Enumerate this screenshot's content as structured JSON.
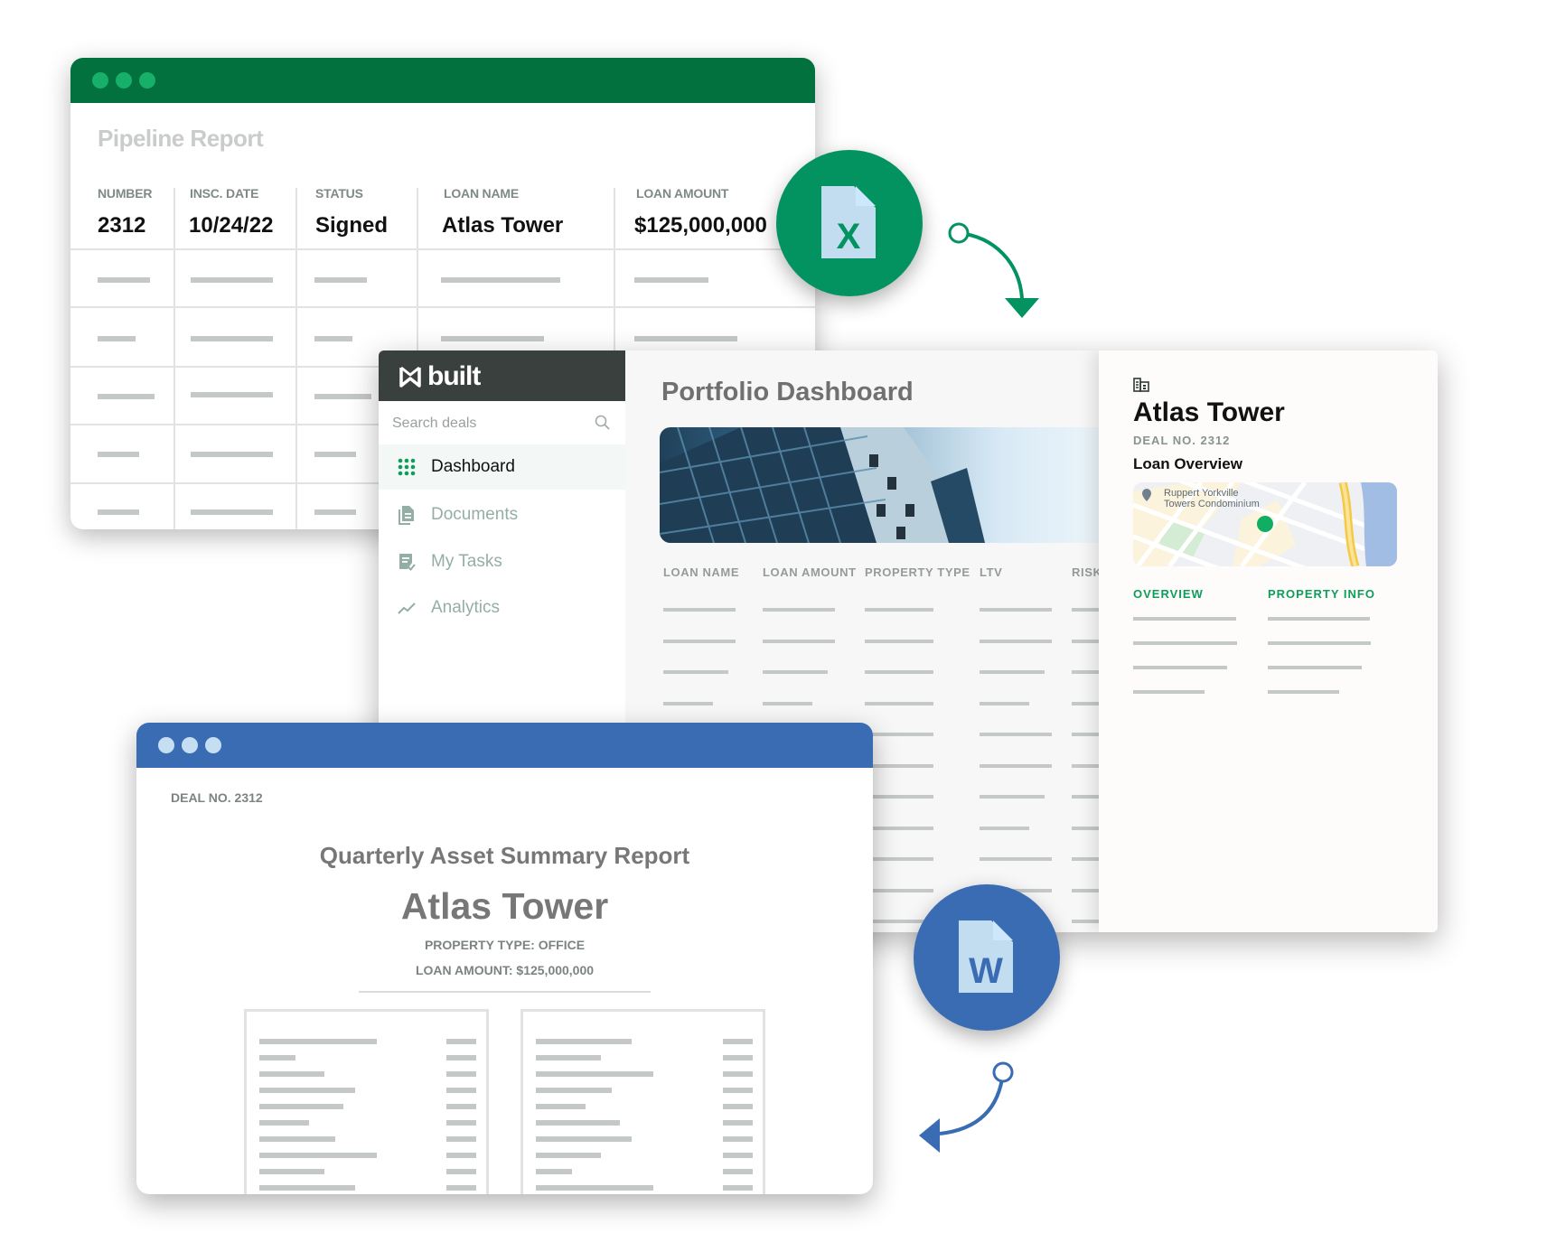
{
  "excel": {
    "title": "Pipeline Report",
    "columns": [
      "NUMBER",
      "INSC. DATE",
      "STATUS",
      "LOAN NAME",
      "LOAN AMOUNT"
    ],
    "row": [
      "2312",
      "10/24/22",
      "Signed",
      "Atlas Tower",
      "$125,000,000"
    ],
    "header_color": "#03713e",
    "badge_icon": "excel-file-icon",
    "badge_letter": "X",
    "badge_color": "#039361"
  },
  "built": {
    "brand": "built",
    "search_placeholder": "Search deals",
    "nav": [
      {
        "label": "Dashboard",
        "icon": "grid-dots-icon",
        "active": true
      },
      {
        "label": "Documents",
        "icon": "document-icon",
        "active": false
      },
      {
        "label": "My Tasks",
        "icon": "task-check-icon",
        "active": false
      },
      {
        "label": "Analytics",
        "icon": "trend-line-icon",
        "active": false
      }
    ],
    "page_title": "Portfolio Dashboard",
    "table_columns": [
      "LOAN NAME",
      "LOAN AMOUNT",
      "PROPERTY TYPE",
      "LTV",
      "RISK"
    ],
    "accent": "#0e9e5c"
  },
  "detail": {
    "icon": "building-icon",
    "title": "Atlas Tower",
    "deal_no": "DEAL NO. 2312",
    "section": "Loan Overview",
    "map_label_1": "Ruppert Yorkville",
    "map_label_2": "Towers Condominium",
    "tabs": [
      "OVERVIEW",
      "PROPERTY INFO"
    ]
  },
  "word": {
    "deal_no": "DEAL NO. 2312",
    "report_title": "Quarterly Asset Summary Report",
    "asset_name": "Atlas Tower",
    "property_type": "PROPERTY TYPE: OFFICE",
    "loan_amount": "LOAN AMOUNT: $125,000,000",
    "header_color": "#3a6cb4",
    "badge_icon": "word-file-icon",
    "badge_letter": "W",
    "badge_color": "#3a6cb4"
  }
}
